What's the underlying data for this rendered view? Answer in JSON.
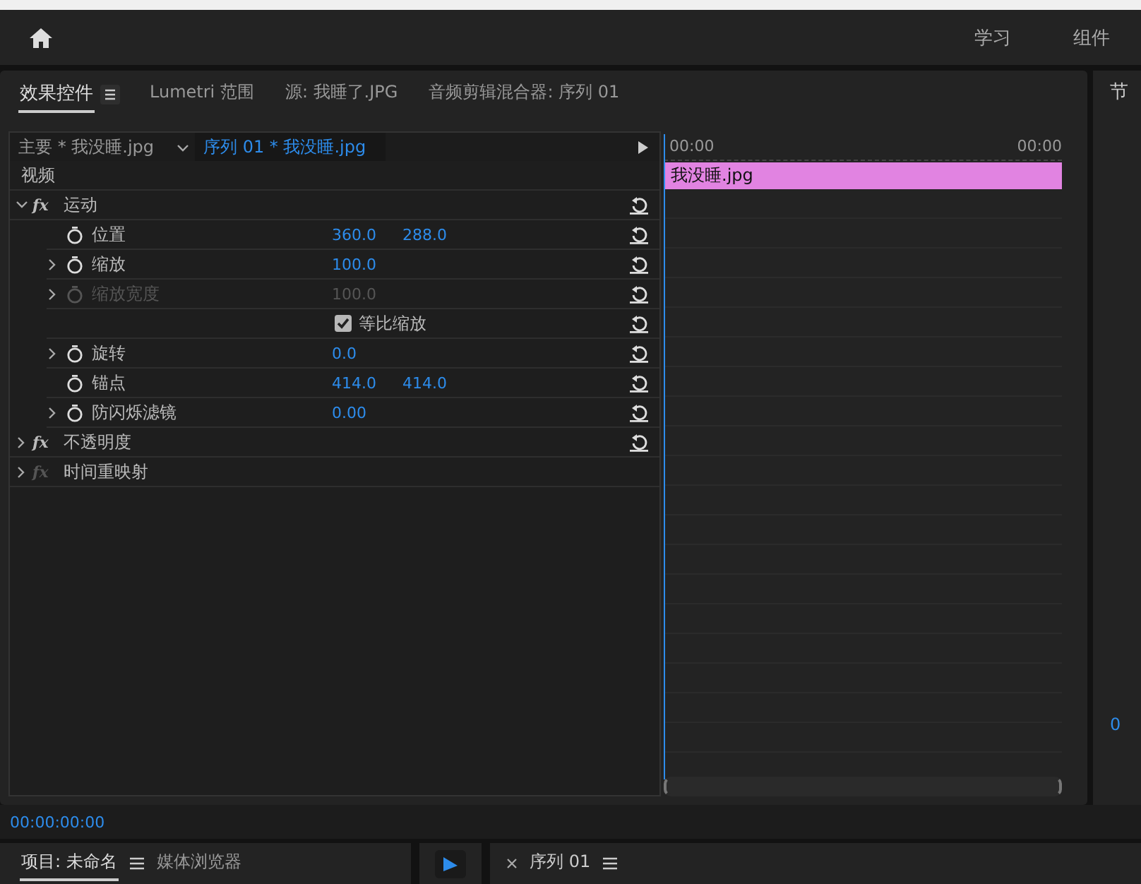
{
  "header": {
    "workspaces": [
      "学习",
      "组件"
    ]
  },
  "panel_tabs": [
    {
      "label": "效果控件",
      "selected": true,
      "menu": true
    },
    {
      "label": "Lumetri 范围",
      "selected": false,
      "menu": false
    },
    {
      "label": "源: 我睡了.JPG",
      "selected": false,
      "menu": false
    },
    {
      "label": "音频剪辑混合器: 序列 01",
      "selected": false,
      "menu": false
    }
  ],
  "side_panel_tab": "节",
  "side_panel_value": "0",
  "clip_tabs": [
    {
      "label": "主要 * 我没睡.jpg",
      "selected": false
    },
    {
      "label": "序列 01 * 我没睡.jpg",
      "selected": true
    }
  ],
  "section": "视频",
  "effects": [
    {
      "name": "运动",
      "fx": "fx",
      "expanded": true,
      "enabled": true,
      "reset": true,
      "params": [
        {
          "kind": "param",
          "name": "位置",
          "expandable": false,
          "disabled": false,
          "values": [
            "360.0",
            "288.0"
          ]
        },
        {
          "kind": "param",
          "name": "缩放",
          "expandable": true,
          "disabled": false,
          "values": [
            "100.0"
          ]
        },
        {
          "kind": "param",
          "name": "缩放宽度",
          "expandable": true,
          "disabled": true,
          "values": [
            "100.0"
          ]
        },
        {
          "kind": "checkbox",
          "name": "等比缩放",
          "checked": true
        },
        {
          "kind": "param",
          "name": "旋转",
          "expandable": true,
          "disabled": false,
          "values": [
            "0.0"
          ]
        },
        {
          "kind": "param",
          "name": "锚点",
          "expandable": false,
          "disabled": false,
          "values": [
            "414.0",
            "414.0"
          ]
        },
        {
          "kind": "param",
          "name": "防闪烁滤镜",
          "expandable": true,
          "disabled": false,
          "values": [
            "0.00"
          ]
        }
      ]
    },
    {
      "name": "不透明度",
      "fx": "fx",
      "expanded": false,
      "enabled": true,
      "reset": true
    },
    {
      "name": "时间重映射",
      "fx": "fx",
      "expanded": false,
      "enabled": false,
      "reset": false
    }
  ],
  "timeline": {
    "start": "00:00",
    "end": "00:00",
    "clip": "我没睡.jpg"
  },
  "timecode": "00:00:00:00",
  "bottom_tabs": [
    {
      "label": "项目: 未命名",
      "selected": true,
      "menu": true
    },
    {
      "label": "媒体浏览器",
      "selected": false,
      "menu": false
    }
  ],
  "sequence_tab": {
    "label": "序列 01",
    "closable": true,
    "menu": true
  }
}
